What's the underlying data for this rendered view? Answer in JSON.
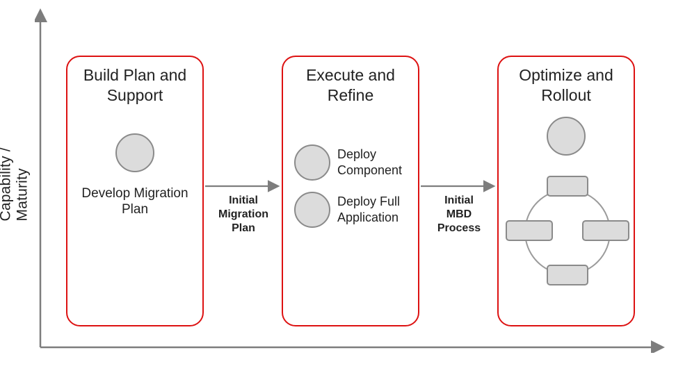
{
  "axes": {
    "y_label": "Capability / Maturity"
  },
  "cards": {
    "c1": {
      "title": "Build Plan and Support",
      "item": "Develop Migration Plan"
    },
    "c2": {
      "title": "Execute and Refine",
      "item_a": "Deploy Component",
      "item_b": "Deploy Full Application"
    },
    "c3": {
      "title": "Optimize and Rollout"
    }
  },
  "arrows": {
    "a1": "Initial Migration Plan",
    "a2": "Initial MBD Process"
  },
  "colors": {
    "card_border": "#d11",
    "axis": "#7d7d7d",
    "shape_fill": "#dcdcdc",
    "shape_stroke": "#8a8a8a"
  }
}
